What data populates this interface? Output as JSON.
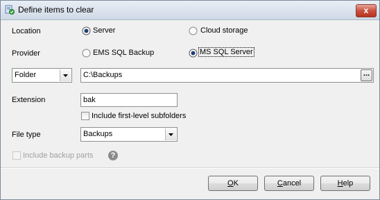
{
  "window": {
    "title": "Define items to clear",
    "close_label": "x"
  },
  "location": {
    "label": "Location",
    "options": [
      {
        "label": "Server",
        "selected": true
      },
      {
        "label": "Cloud storage",
        "selected": false
      }
    ]
  },
  "provider": {
    "label": "Provider",
    "options": [
      {
        "label": "EMS SQL Backup",
        "selected": false
      },
      {
        "label": "MS SQL Server",
        "selected": true
      }
    ]
  },
  "source": {
    "type_value": "Folder",
    "path_value": "C:\\Backups",
    "browse_label": "..."
  },
  "extension": {
    "label": "Extension",
    "value": "bak"
  },
  "subfolders": {
    "label": "Include first-level subfolders",
    "checked": false
  },
  "file_type": {
    "label": "File type",
    "value": "Backups"
  },
  "backup_parts": {
    "label": "Include backup parts",
    "checked": false,
    "enabled": false
  },
  "help_icon_glyph": "?",
  "buttons": {
    "ok": {
      "mnemonic": "O",
      "rest": "K"
    },
    "cancel": {
      "mnemonic": "C",
      "rest": "ancel"
    },
    "help": {
      "mnemonic": "H",
      "rest": "elp"
    }
  }
}
